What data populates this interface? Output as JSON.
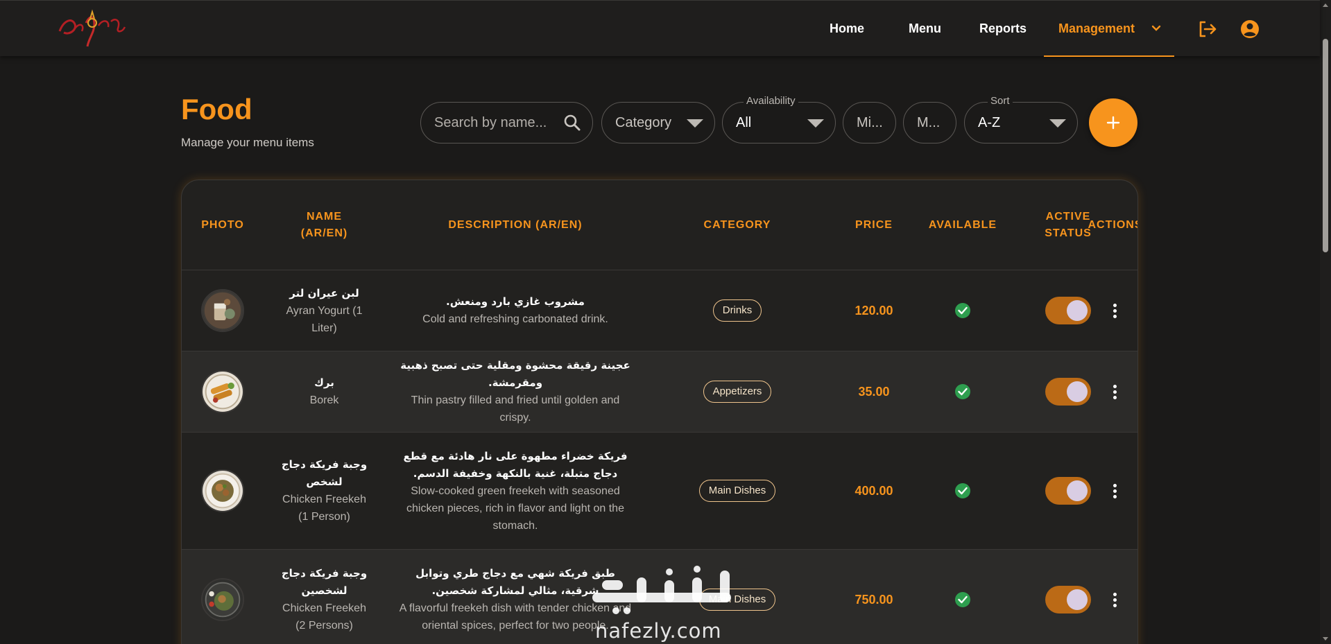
{
  "nav": {
    "items": [
      {
        "label": "Home"
      },
      {
        "label": "Menu"
      },
      {
        "label": "Reports"
      },
      {
        "label": "Management",
        "active": true
      }
    ]
  },
  "colors": {
    "accent": "#f7941d",
    "background": "#1b1a19",
    "available": "#2e9e4f"
  },
  "header": {
    "title": "Food",
    "subtitle": "Manage your menu items"
  },
  "filters": {
    "search_placeholder": "Search by name...",
    "category_placeholder": "Category",
    "availability_label": "Availability",
    "availability_value": "All",
    "min_placeholder": "Mi...",
    "max_placeholder": "M...",
    "sort_label": "Sort",
    "sort_value": "A-Z"
  },
  "table": {
    "columns": [
      "PHOTO",
      "NAME (AR/EN)",
      "DESCRIPTION (AR/EN)",
      "CATEGORY",
      "PRICE",
      "AVAILABLE",
      "ACTIVE STATUS",
      "ACTIONS"
    ],
    "rows": [
      {
        "name_ar": "لبن عيران لتر",
        "name_en": "Ayran Yogurt (1 Liter)",
        "desc_ar": "مشروب غازي بارد ومنعش.",
        "desc_en": "Cold and refreshing carbonated drink.",
        "category": "Drinks",
        "price": "120.00",
        "available": true,
        "active": true
      },
      {
        "name_ar": "برك",
        "name_en": "Borek",
        "desc_ar": "عجينة رقيقة محشوة ومقلية حتى تصبح ذهبية ومقرمشة.",
        "desc_en": "Thin pastry filled and fried until golden and crispy.",
        "category": "Appetizers",
        "price": "35.00",
        "available": true,
        "active": true
      },
      {
        "name_ar": "وجبة فريكة دجاج لشخص",
        "name_en": "Chicken Freekeh (1 Person)",
        "desc_ar": "فريكة خضراء مطهوة على نار هادئة مع قطع دجاج متبلة، غنية بالنكهة وخفيفة الدسم.",
        "desc_en": "Slow-cooked green freekeh with seasoned chicken pieces, rich in flavor and light on the stomach.",
        "category": "Main Dishes",
        "price": "400.00",
        "available": true,
        "active": true
      },
      {
        "name_ar": "وجبة فريكة دجاج لشخصين",
        "name_en": "Chicken Freekeh (2 Persons)",
        "desc_ar": "طبق فريكة شهي مع دجاج طري وتوابل شرقية، مثالي لمشاركة شخصين.",
        "desc_en": "A flavorful freekeh dish with tender chicken and oriental spices, perfect for two people.",
        "category": "Main Dishes",
        "price": "750.00",
        "available": true,
        "active": true
      }
    ]
  },
  "watermark": {
    "latin": "nafezly.com",
    "arabic": "نفذلي"
  }
}
